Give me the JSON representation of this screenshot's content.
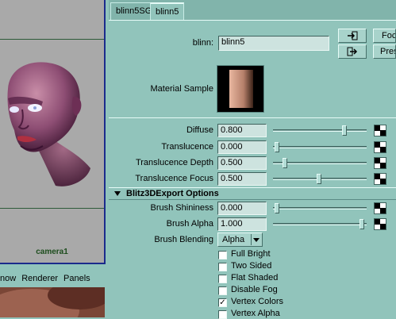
{
  "viewport": {
    "camera_label": "camera1"
  },
  "panel_menu": [
    "now",
    "Renderer",
    "Panels"
  ],
  "tabs": [
    {
      "label": "blinn5SG",
      "active": false
    },
    {
      "label": "blinn5",
      "active": true
    }
  ],
  "material": {
    "type_label": "blinn:",
    "name_value": "blinn5",
    "focus_label": "Foc",
    "presets_label": "Pres",
    "sample_label": "Material Sample"
  },
  "attributes": [
    {
      "label": "Diffuse",
      "value": "0.800",
      "slider": 0.8
    },
    {
      "label": "Translucence",
      "value": "0.000",
      "slider": 0.0
    },
    {
      "label": "Translucence Depth",
      "value": "0.500",
      "slider": 0.1
    },
    {
      "label": "Translucence Focus",
      "value": "0.500",
      "slider": 0.5
    }
  ],
  "blitz": {
    "section_title": "Blitz3DExport Options",
    "brush_shininess_label": "Brush Shininess",
    "brush_shininess_value": "0.000",
    "brush_shininess_slider": 0.0,
    "brush_alpha_label": "Brush Alpha",
    "brush_alpha_value": "1.000",
    "brush_alpha_slider": 1.0,
    "brush_blending_label": "Brush Blending",
    "brush_blending_value": "Alpha",
    "checkboxes": [
      {
        "label": "Full Bright",
        "checked": false
      },
      {
        "label": "Two Sided",
        "checked": false
      },
      {
        "label": "Flat Shaded",
        "checked": false
      },
      {
        "label": "Disable Fog",
        "checked": false
      },
      {
        "label": "Vertex Colors",
        "checked": true
      },
      {
        "label": "Vertex Alpha",
        "checked": false
      }
    ]
  },
  "colors": {
    "panel_bg": "#91c4bb",
    "viewport_bg": "#a9a9a9",
    "viewport_border": "#1b2b8c",
    "camera_text": "#1d4d1d"
  }
}
